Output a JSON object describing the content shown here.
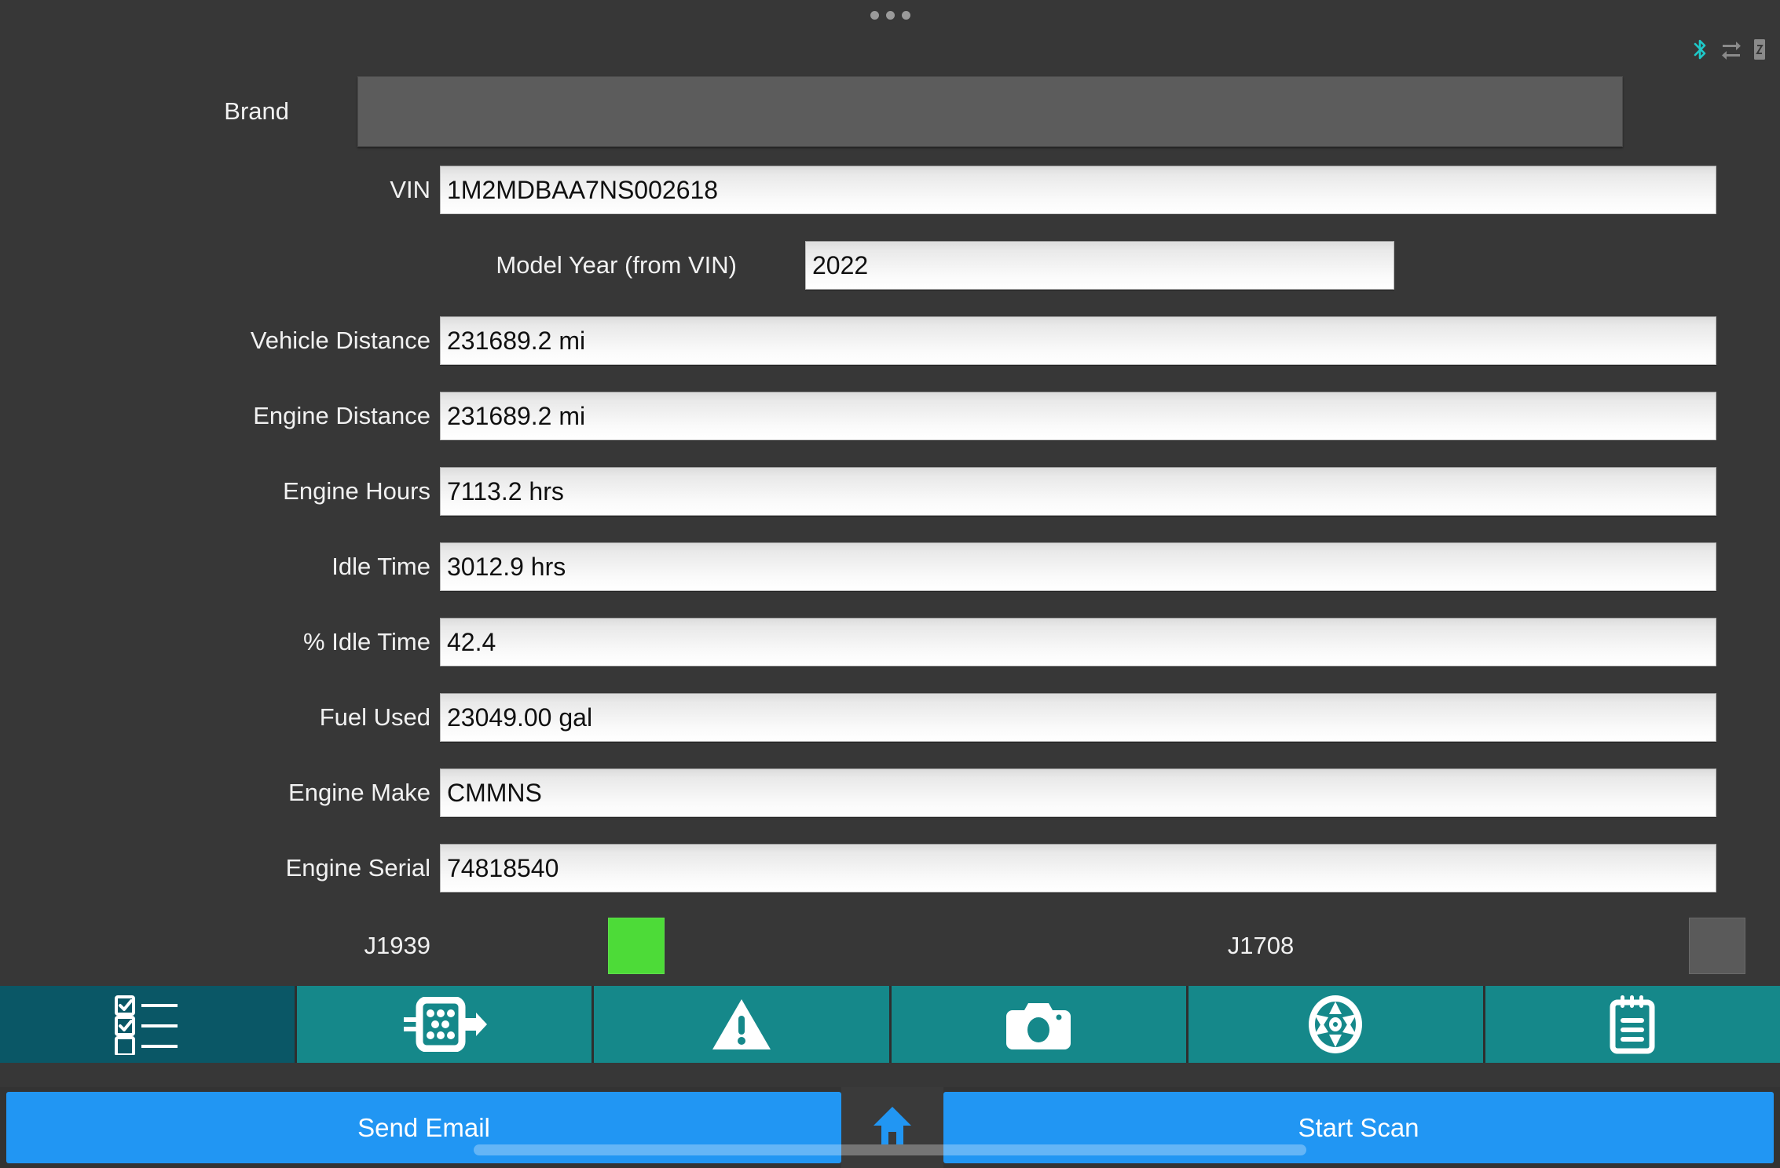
{
  "window": {
    "drag_handle": "drag-handle-dots",
    "background": "#373737"
  },
  "status_bar": {
    "icons": [
      {
        "name": "bluetooth-icon",
        "color": "#1ec8c8"
      },
      {
        "name": "data-transfer-icon",
        "color": "#8a8a8a"
      },
      {
        "name": "device-icon",
        "color": "#8a8a8a"
      }
    ]
  },
  "form": {
    "fields": [
      {
        "label": "Brand",
        "value": "",
        "type": "spinner"
      },
      {
        "label": "VIN",
        "value": "1M2MDBAA7NS002618",
        "type": "text"
      },
      {
        "label": "Model Year (from VIN)",
        "value": "2022",
        "type": "text"
      },
      {
        "label": "Vehicle Distance",
        "value": "231689.2 mi",
        "type": "text"
      },
      {
        "label": "Engine Distance",
        "value": "231689.2 mi",
        "type": "text"
      },
      {
        "label": "Engine Hours",
        "value": "7113.2 hrs",
        "type": "text"
      },
      {
        "label": "Idle Time",
        "value": "3012.9 hrs",
        "type": "text"
      },
      {
        "label": "% Idle Time",
        "value": "42.4",
        "type": "text"
      },
      {
        "label": "Fuel Used",
        "value": "23049.00 gal",
        "type": "text"
      },
      {
        "label": "Engine Make",
        "value": "CMMNS",
        "type": "text"
      },
      {
        "label": "Engine Serial",
        "value": "74818540",
        "type": "text"
      }
    ]
  },
  "protocols": [
    {
      "label": "J1939",
      "status": "active",
      "color": "#4ddb38"
    },
    {
      "label": "J1708",
      "status": "inactive",
      "color": "#5a5a5a"
    }
  ],
  "tabbar": {
    "active_index": 0,
    "active_color": "#0a5766",
    "color": "#15888a",
    "tabs": [
      {
        "icon": "checklist-icon",
        "label": "Checklist"
      },
      {
        "icon": "connector-plug-icon",
        "label": "Connector"
      },
      {
        "icon": "warning-triangle-icon",
        "label": "Faults"
      },
      {
        "icon": "camera-icon",
        "label": "Camera"
      },
      {
        "icon": "wheel-icon",
        "label": "Tires"
      },
      {
        "icon": "notepad-icon",
        "label": "Notes"
      }
    ]
  },
  "action_bar": {
    "send_email_label": "Send Email",
    "home_icon": "home-icon",
    "start_scan_label": "Start Scan",
    "accent_color": "#2196f3"
  }
}
